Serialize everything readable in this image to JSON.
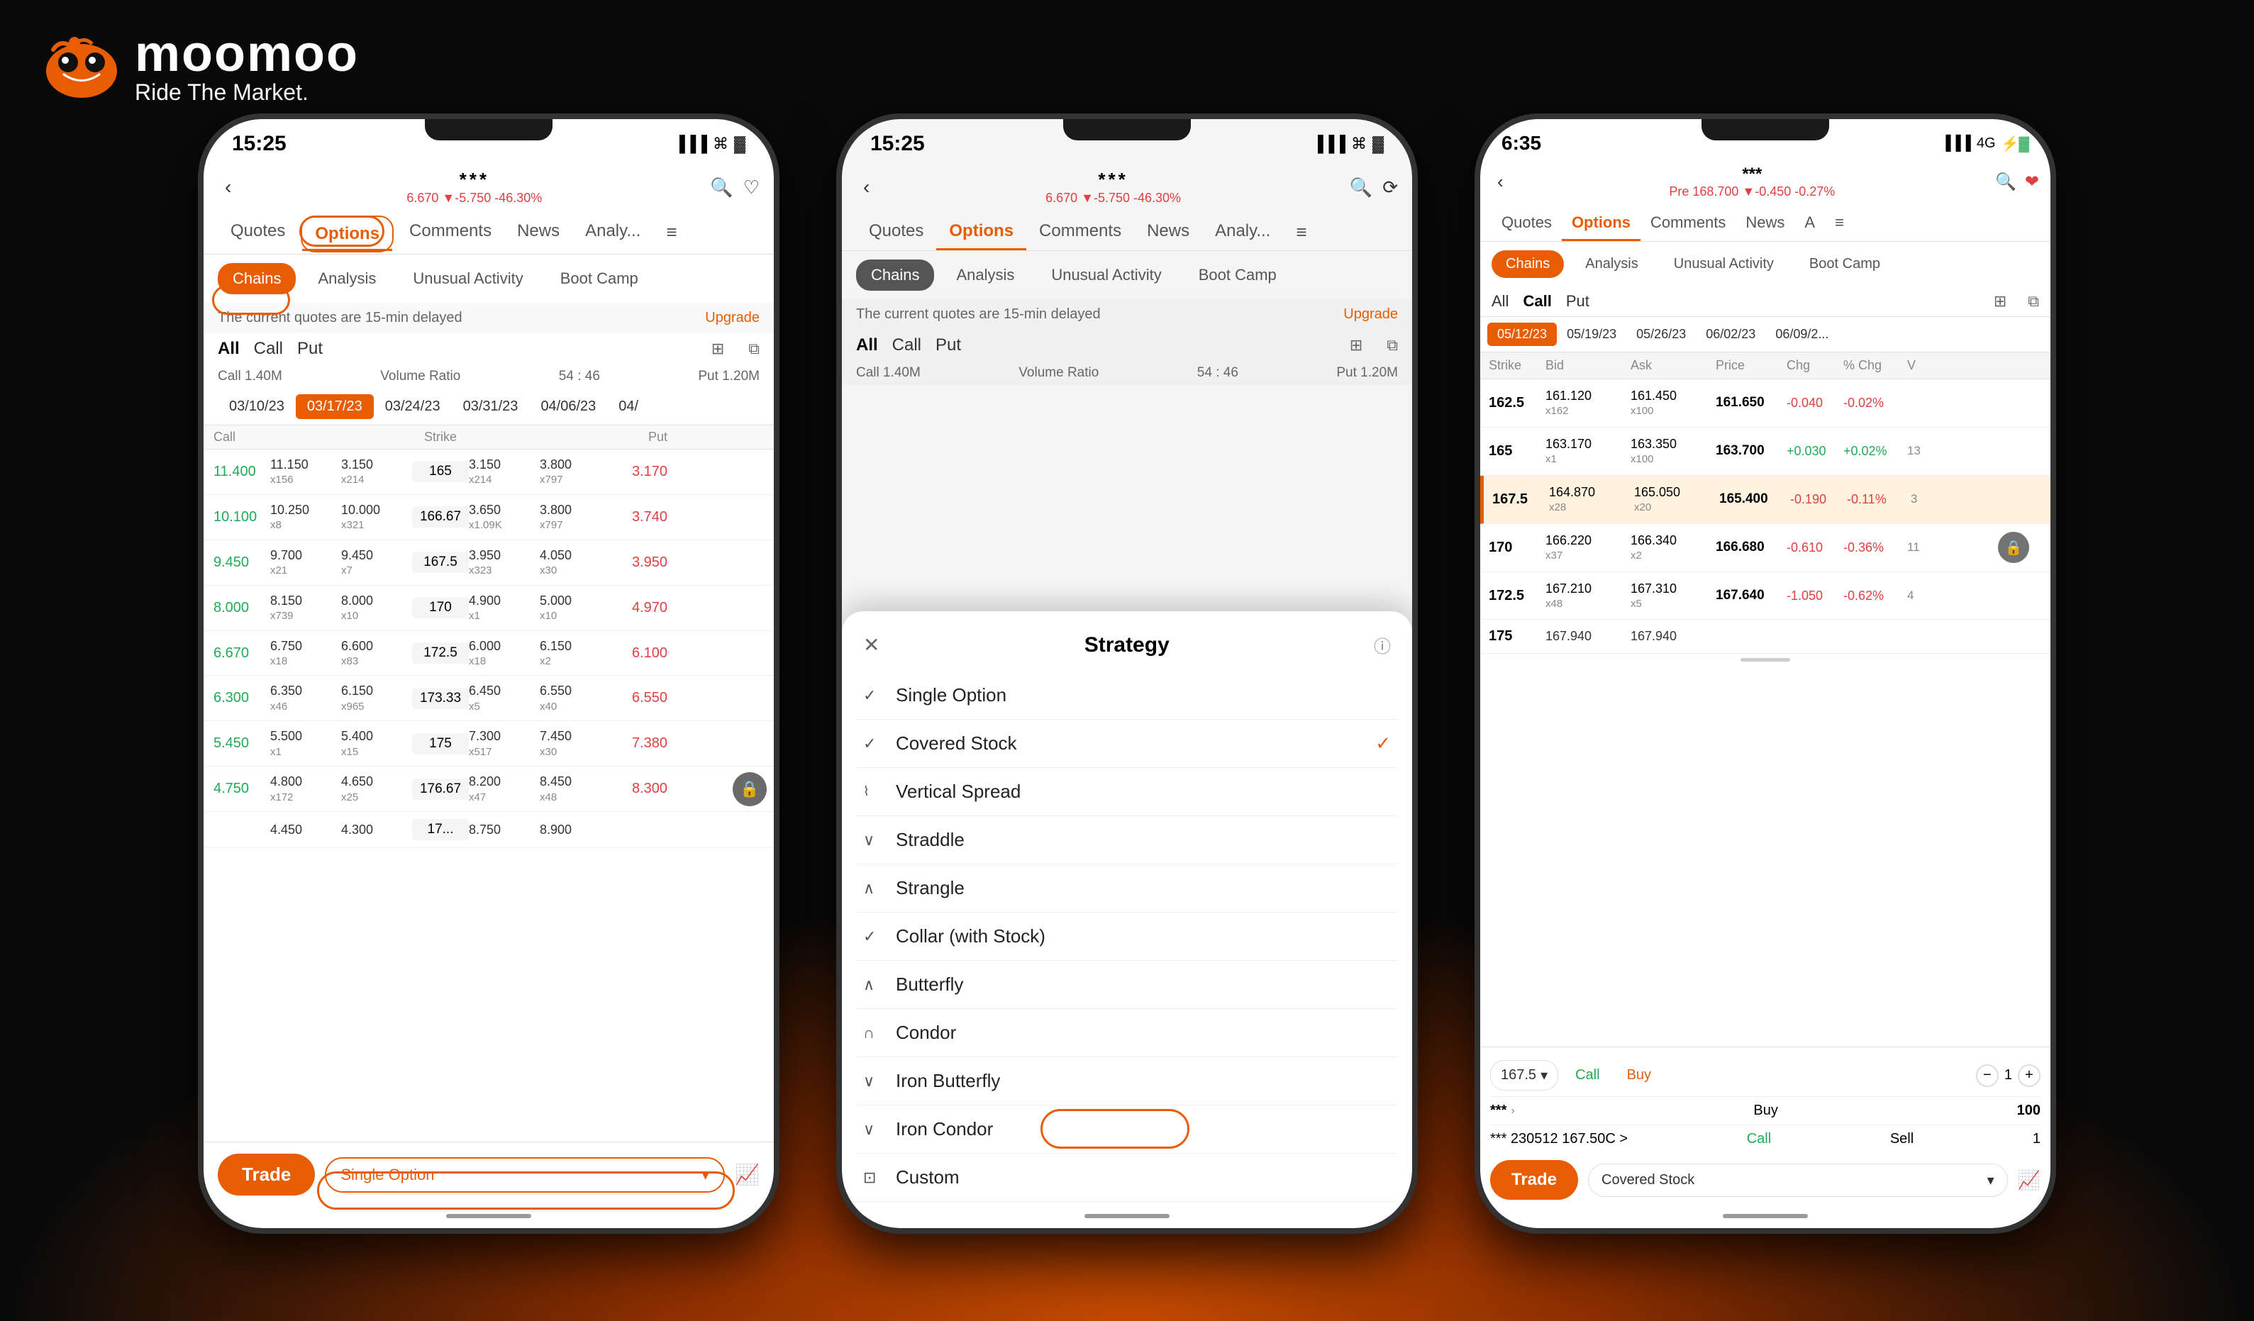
{
  "app": {
    "brand": "moomoo",
    "tagline": "Ride The Market."
  },
  "phone1": {
    "statusTime": "15:25",
    "stockName": "***",
    "stockPrice": "6.670 ▼-5.750 -46.30%",
    "tabs": [
      "Quotes",
      "Options",
      "Comments",
      "News",
      "Analy...",
      "≡"
    ],
    "activeTab": "Options",
    "subTabs": [
      "Chains",
      "Analysis",
      "Unusual Activity",
      "Boot Camp"
    ],
    "activeSubTab": "Chains",
    "delayNotice": "The current quotes are 15-min delayed",
    "upgradeLabel": "Upgrade",
    "acpTabs": [
      "All",
      "Call",
      "Put"
    ],
    "volumeLabel": "Volume Ratio",
    "volumeValue": "54 : 46",
    "callVolume": "Call 1.40M",
    "putVolume": "Put 1.20M",
    "dates": [
      "03/10/23",
      "03/17/23",
      "03/24/23",
      "03/31/23",
      "04/06/23",
      "04/"
    ],
    "activeDate": "03/17/23",
    "tableHeaders": [
      "Call",
      "",
      "",
      "Strike",
      "",
      "",
      "Put"
    ],
    "tableRows": [
      {
        "callPrice": "11.400",
        "ask": "11.150\nx156",
        "bid": "3.150\nx214",
        "strike": "165",
        "bid2": "3.150\nx214",
        "ask2": "3.800\nx797",
        "putPrice": "3.170"
      },
      {
        "callPrice": "10.100",
        "ask": "10.250\nx8",
        "bid": "10.000\nx321",
        "strike": "166.67",
        "bid2": "3.650\nx1.09K",
        "ask2": "3.800\nx797",
        "putPrice": "3.740"
      },
      {
        "callPrice": "9.450",
        "ask": "9.700\nx21",
        "bid": "9.450\nx7",
        "strike": "167.5",
        "bid2": "3.950\nx323",
        "ask2": "4.050\nx30",
        "putPrice": "3.950"
      },
      {
        "callPrice": "8.000",
        "ask": "8.150\nx739",
        "bid": "8.000\nx10",
        "strike": "170",
        "bid2": "4.900\nx1",
        "ask2": "5.000\nx10",
        "putPrice": "4.970"
      },
      {
        "callPrice": "6.670",
        "ask": "6.750\nx18",
        "bid": "6.600\nx83",
        "strike": "172.5",
        "bid2": "6.000\nx18",
        "ask2": "6.150\nx2",
        "putPrice": "6.100"
      },
      {
        "callPrice": "6.300",
        "ask": "6.350\nx46",
        "bid": "6.150\nx965",
        "strike": "173.33",
        "bid2": "6.450\nx5",
        "ask2": "6.550\nx40",
        "putPrice": "6.550"
      },
      {
        "callPrice": "5.450",
        "ask": "5.500\nx1",
        "bid": "5.400\nx15",
        "strike": "175",
        "bid2": "7.300\nx517",
        "ask2": "7.450\nx30",
        "putPrice": "7.380"
      },
      {
        "callPrice": "4.750",
        "ask": "4.800\nx172",
        "bid": "4.650\nx25",
        "strike": "176.67",
        "bid2": "8.200\nx47",
        "ask2": "8.450\nx48",
        "putPrice": "8.300"
      },
      {
        "callPrice": "",
        "ask": "4.450",
        "bid": "4.300",
        "strike": "17...",
        "bid2": "8.750",
        "ask2": "8.900",
        "putPrice": ""
      }
    ],
    "tradeLabel": "Trade",
    "strategyLabel": "Single Option",
    "chartIcon": "chart-icon"
  },
  "phone2": {
    "statusTime": "15:25",
    "stockName": "***",
    "stockPrice": "6.670 ▼-5.750 -46.30%",
    "tabs": [
      "Quotes",
      "Options",
      "Comments",
      "News",
      "Analy...",
      "≡"
    ],
    "activeTab": "Options",
    "subTabs": [
      "Chains",
      "Analysis",
      "Unusual Activity",
      "Boot Camp"
    ],
    "activeSubTab": "Chains",
    "delayNotice": "The current quotes are 15-min delayed",
    "upgradeLabel": "Upgrade",
    "acpTabs": [
      "All",
      "Call",
      "Put"
    ],
    "volumeLabel": "Volume Ratio",
    "volumeValue": "54 : 46",
    "callVolume": "Call 1.40M",
    "putVolume": "Put 1.20M",
    "modalTitle": "Strategy",
    "modalItems": [
      {
        "icon": "✓",
        "label": "Single Option",
        "checked": false
      },
      {
        "icon": "✓",
        "label": "Covered Stock",
        "checked": true
      },
      {
        "icon": "⌇",
        "label": "Vertical Spread",
        "checked": false
      },
      {
        "icon": "∨",
        "label": "Straddle",
        "checked": false
      },
      {
        "icon": "∧",
        "label": "Strangle",
        "checked": false
      },
      {
        "icon": "✓",
        "label": "Collar (with Stock)",
        "checked": false
      },
      {
        "icon": "∧",
        "label": "Butterfly",
        "checked": false
      },
      {
        "icon": "∩",
        "label": "Condor",
        "checked": false
      },
      {
        "icon": "∨",
        "label": "Iron Butterfly",
        "checked": false
      },
      {
        "icon": "∨",
        "label": "Iron Condor",
        "checked": false
      },
      {
        "icon": "⊡",
        "label": "Custom",
        "checked": false
      }
    ]
  },
  "phone3": {
    "statusTime": "6:35",
    "stockName": "***",
    "stockPrice": "Pre 168.700 ▼-0.450 -0.27%",
    "tabs": [
      "Quotes",
      "Options",
      "Comments",
      "News",
      "A",
      "≡"
    ],
    "activeTab": "Options",
    "subTabs": [
      "Chains",
      "Analysis",
      "Unusual Activity",
      "Boot Camp"
    ],
    "activeSubTab": "Chains",
    "acpTabs": [
      "All",
      "Call",
      "Put"
    ],
    "dates": [
      "05/12/23",
      "05/19/23",
      "05/26/23",
      "06/02/23",
      "06/09/2..."
    ],
    "activeDate": "05/12/23",
    "tableHeaders": [
      "Strike",
      "Bid",
      "Ask",
      "Price",
      "Chg",
      "% Chg",
      "V"
    ],
    "tableRows": [
      {
        "strike": "162.5",
        "bid": "161.120\nx162",
        "ask": "161.450\nx100",
        "price": "161.650",
        "chg": "-0.040",
        "pchg": "-0.02%"
      },
      {
        "strike": "165",
        "bid": "163.170\nx1",
        "ask": "163.350\nx100",
        "price": "163.700",
        "chg": "+0.030",
        "pchg": "+0.02%",
        "highlight": false
      },
      {
        "strike": "167.5",
        "bid": "164.870\nx28",
        "ask": "165.050\nx20",
        "price": "165.400",
        "chg": "-0.190",
        "pchg": "-0.11%",
        "highlight": true
      },
      {
        "strike": "170",
        "bid": "166.220\nx37",
        "ask": "166.340\nx2",
        "price": "166.680",
        "chg": "-0.610",
        "pchg": "-0.36%"
      },
      {
        "strike": "172.5",
        "bid": "167.210\nx48",
        "ask": "167.310\nx5",
        "price": "167.640",
        "chg": "-1.050",
        "pchg": "-0.62%"
      },
      {
        "strike": "175",
        "bid": "167.940",
        "ask": "167.940",
        "price": "",
        "chg": "",
        "pchg": ""
      }
    ],
    "orderStrike": "167.5",
    "orderType": "Call",
    "orderSide": "Buy",
    "orderQty": "1",
    "ticker1": "***",
    "ticker1Label": "Buy",
    "ticker1Qty": "100",
    "ticker2": "*** 230512 167.50C >",
    "ticker2Type": "Call",
    "ticker2Side": "Sell",
    "ticker2Qty": "1",
    "tradeLabel": "Trade",
    "coveredStockLabel": "Covered Stock"
  }
}
